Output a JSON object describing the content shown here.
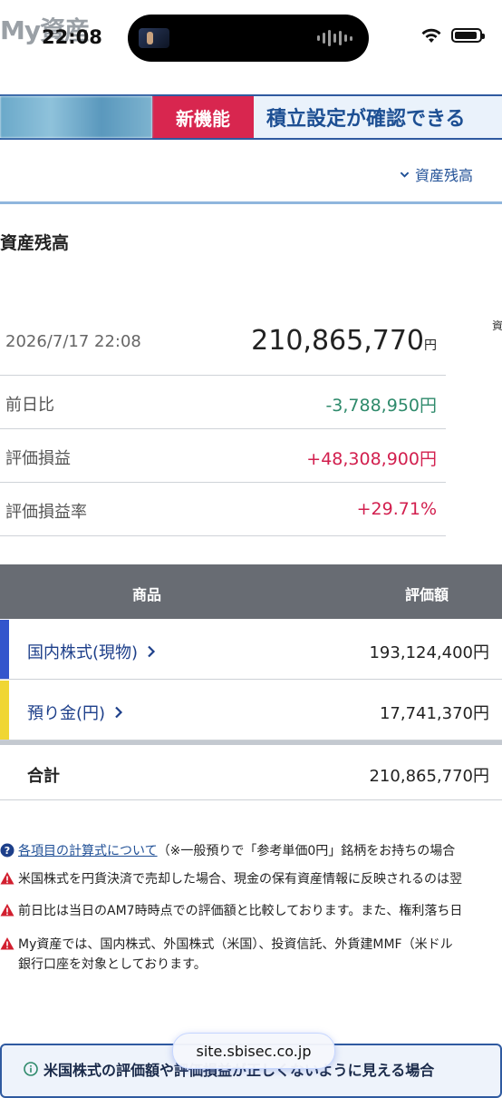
{
  "status_bar": {
    "page_title": "My資産",
    "time": "22:08"
  },
  "banner": {
    "tag": "新機能",
    "message": "積立設定が確認できる"
  },
  "nav": {
    "anchor_link": "資産残高"
  },
  "summary": {
    "section_title": "資産残高",
    "side_label": "資",
    "timestamp": "2026/7/17 22:08",
    "total_value": "210,865,770",
    "currency_unit": "円",
    "rows": [
      {
        "label": "前日比",
        "value": "-3,788,950円"
      },
      {
        "label": "評価損益",
        "value": "+48,308,900円"
      },
      {
        "label": "評価損益率",
        "value": "+29.71%"
      }
    ]
  },
  "holdings": {
    "header_product": "商品",
    "header_value": "評価額",
    "rows": [
      {
        "name": "国内株式(現物)",
        "amount": "193,124,400円",
        "stripe_color": "#3355cc"
      },
      {
        "name": "預り金(円)",
        "amount": "17,741,370円",
        "stripe_color": "#f0d633"
      }
    ],
    "total_label": "合計",
    "total_amount": "210,865,770円"
  },
  "notes": {
    "calc_link": "各項目の計算式について",
    "calc_rest": "（※一般預りで「参考単価0円」銘柄をお持ちの場合",
    "warning1": "米国株式を円貨決済で売却した場合、現金の保有資産情報に反映されるのは翌",
    "warning2": "前日比は当日のAM7時時点での評価額と比較しております。また、権利落ち日",
    "warning3_line1": "My資産では、国内株式、外国株式（米国）、投資信託、外貨建MMF（米ドル",
    "warning3_line2": "銀行口座を対象としております。"
  },
  "info_box": {
    "title": "米国株式の評価額や評価損益が正しくないように見える場合"
  },
  "browser": {
    "url": "site.sbisec.co.jp"
  },
  "colors": {
    "positive": "#d21f4e",
    "negative": "#2e8a6b",
    "link": "#1f4f96",
    "table_header": "#686c73"
  }
}
